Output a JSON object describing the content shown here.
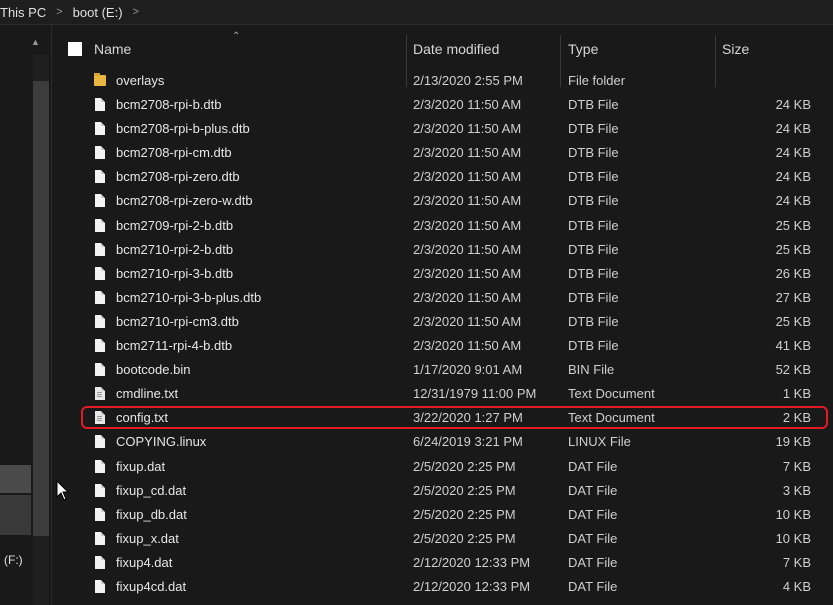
{
  "breadcrumb": {
    "items": [
      "This PC",
      "boot (E:)"
    ]
  },
  "nav": {
    "drive_label": "(F:)"
  },
  "columns": {
    "name": "Name",
    "date": "Date modified",
    "type": "Type",
    "size": "Size"
  },
  "rows": [
    {
      "name": "overlays",
      "date": "2/13/2020 2:55 PM",
      "type": "File folder",
      "size": "",
      "icon": "folder-icon"
    },
    {
      "name": "bcm2708-rpi-b.dtb",
      "date": "2/3/2020 11:50 AM",
      "type": "DTB File",
      "size": "24 KB",
      "icon": "file-icon"
    },
    {
      "name": "bcm2708-rpi-b-plus.dtb",
      "date": "2/3/2020 11:50 AM",
      "type": "DTB File",
      "size": "24 KB",
      "icon": "file-icon"
    },
    {
      "name": "bcm2708-rpi-cm.dtb",
      "date": "2/3/2020 11:50 AM",
      "type": "DTB File",
      "size": "24 KB",
      "icon": "file-icon"
    },
    {
      "name": "bcm2708-rpi-zero.dtb",
      "date": "2/3/2020 11:50 AM",
      "type": "DTB File",
      "size": "24 KB",
      "icon": "file-icon"
    },
    {
      "name": "bcm2708-rpi-zero-w.dtb",
      "date": "2/3/2020 11:50 AM",
      "type": "DTB File",
      "size": "24 KB",
      "icon": "file-icon"
    },
    {
      "name": "bcm2709-rpi-2-b.dtb",
      "date": "2/3/2020 11:50 AM",
      "type": "DTB File",
      "size": "25 KB",
      "icon": "file-icon"
    },
    {
      "name": "bcm2710-rpi-2-b.dtb",
      "date": "2/3/2020 11:50 AM",
      "type": "DTB File",
      "size": "25 KB",
      "icon": "file-icon"
    },
    {
      "name": "bcm2710-rpi-3-b.dtb",
      "date": "2/3/2020 11:50 AM",
      "type": "DTB File",
      "size": "26 KB",
      "icon": "file-icon"
    },
    {
      "name": "bcm2710-rpi-3-b-plus.dtb",
      "date": "2/3/2020 11:50 AM",
      "type": "DTB File",
      "size": "27 KB",
      "icon": "file-icon"
    },
    {
      "name": "bcm2710-rpi-cm3.dtb",
      "date": "2/3/2020 11:50 AM",
      "type": "DTB File",
      "size": "25 KB",
      "icon": "file-icon"
    },
    {
      "name": "bcm2711-rpi-4-b.dtb",
      "date": "2/3/2020 11:50 AM",
      "type": "DTB File",
      "size": "41 KB",
      "icon": "file-icon"
    },
    {
      "name": "bootcode.bin",
      "date": "1/17/2020 9:01 AM",
      "type": "BIN File",
      "size": "52 KB",
      "icon": "file-icon"
    },
    {
      "name": "cmdline.txt",
      "date": "12/31/1979 11:00 PM",
      "type": "Text Document",
      "size": "1 KB",
      "icon": "text-file-icon"
    },
    {
      "name": "config.txt",
      "date": "3/22/2020 1:27 PM",
      "type": "Text Document",
      "size": "2 KB",
      "icon": "text-file-icon"
    },
    {
      "name": "COPYING.linux",
      "date": "6/24/2019 3:21 PM",
      "type": "LINUX File",
      "size": "19 KB",
      "icon": "file-icon"
    },
    {
      "name": "fixup.dat",
      "date": "2/5/2020 2:25 PM",
      "type": "DAT File",
      "size": "7 KB",
      "icon": "file-icon"
    },
    {
      "name": "fixup_cd.dat",
      "date": "2/5/2020 2:25 PM",
      "type": "DAT File",
      "size": "3 KB",
      "icon": "file-icon"
    },
    {
      "name": "fixup_db.dat",
      "date": "2/5/2020 2:25 PM",
      "type": "DAT File",
      "size": "10 KB",
      "icon": "file-icon"
    },
    {
      "name": "fixup_x.dat",
      "date": "2/5/2020 2:25 PM",
      "type": "DAT File",
      "size": "10 KB",
      "icon": "file-icon"
    },
    {
      "name": "fixup4.dat",
      "date": "2/12/2020 12:33 PM",
      "type": "DAT File",
      "size": "7 KB",
      "icon": "file-icon"
    },
    {
      "name": "fixup4cd.dat",
      "date": "2/12/2020 12:33 PM",
      "type": "DAT File",
      "size": "4 KB",
      "icon": "file-icon"
    }
  ],
  "highlight_color": "#e01b24"
}
